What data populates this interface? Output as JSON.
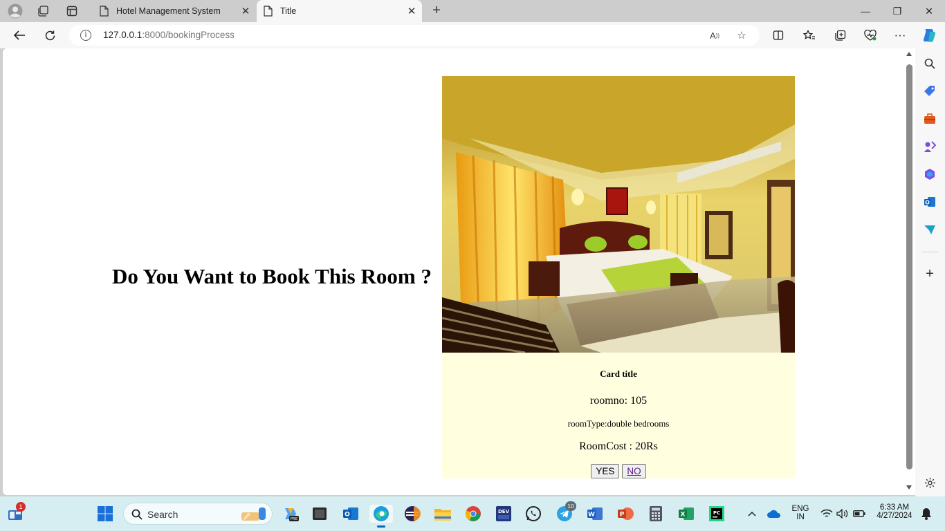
{
  "browser": {
    "tabs": [
      {
        "label": "Hotel Management System",
        "active": false
      },
      {
        "label": "Title",
        "active": true
      }
    ],
    "url_host": "127.0.0.1",
    "url_rest": ":8000/bookingProcess"
  },
  "page": {
    "heading": "Do You Want to Book This Room ?",
    "card": {
      "title": "Card title",
      "room_no": "roomno: 105",
      "room_type": "roomType:double bedrooms",
      "room_cost": "RoomCost : 20Rs",
      "yes_label": "YES",
      "no_label": "NO",
      "background": "#ffffe0"
    }
  },
  "taskbar": {
    "search_placeholder": "Search",
    "lang_top": "ENG",
    "lang_bottom": "IN",
    "time": "6:33 AM",
    "date": "4/27/2024",
    "badge_widgets": "1",
    "badge_telegram": "10",
    "background": "#d6eef1"
  }
}
